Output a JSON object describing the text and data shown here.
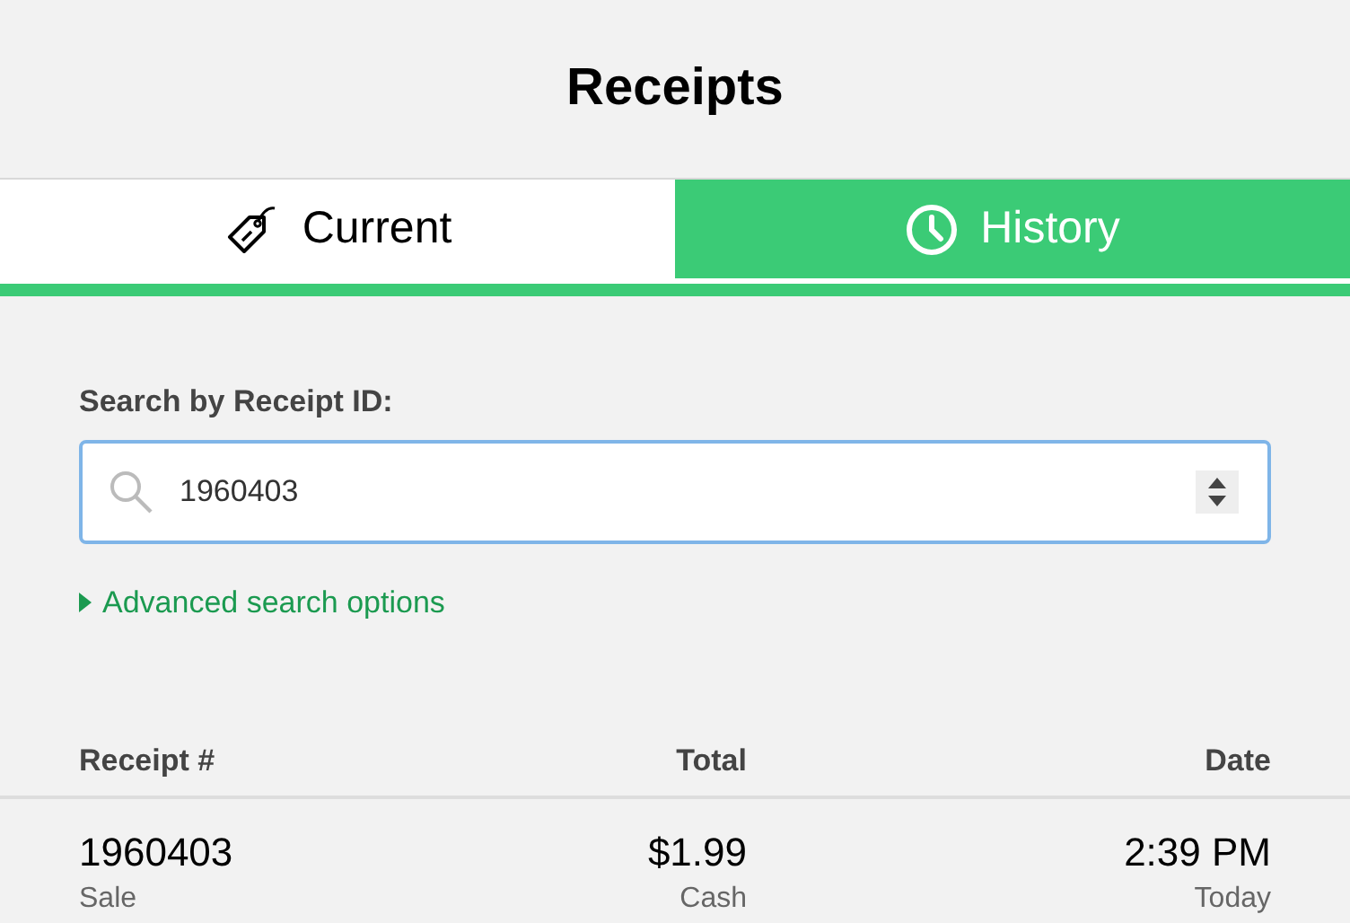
{
  "title": "Receipts",
  "tabs": [
    {
      "label": "Current",
      "kind": "tag",
      "selected": false
    },
    {
      "label": "History",
      "kind": "clock",
      "selected": true
    }
  ],
  "search": {
    "label": "Search by Receipt ID:",
    "value": "1960403"
  },
  "advanced_link": "Advanced search options",
  "table": {
    "columns": [
      "Receipt #",
      "Total",
      "Date"
    ],
    "rows": [
      {
        "cells": [
          {
            "main": "1960403",
            "sub": "Sale"
          },
          {
            "main": "$1.99",
            "sub": "Cash"
          },
          {
            "main": "2:39 PM",
            "sub": "Today"
          }
        ]
      }
    ]
  }
}
